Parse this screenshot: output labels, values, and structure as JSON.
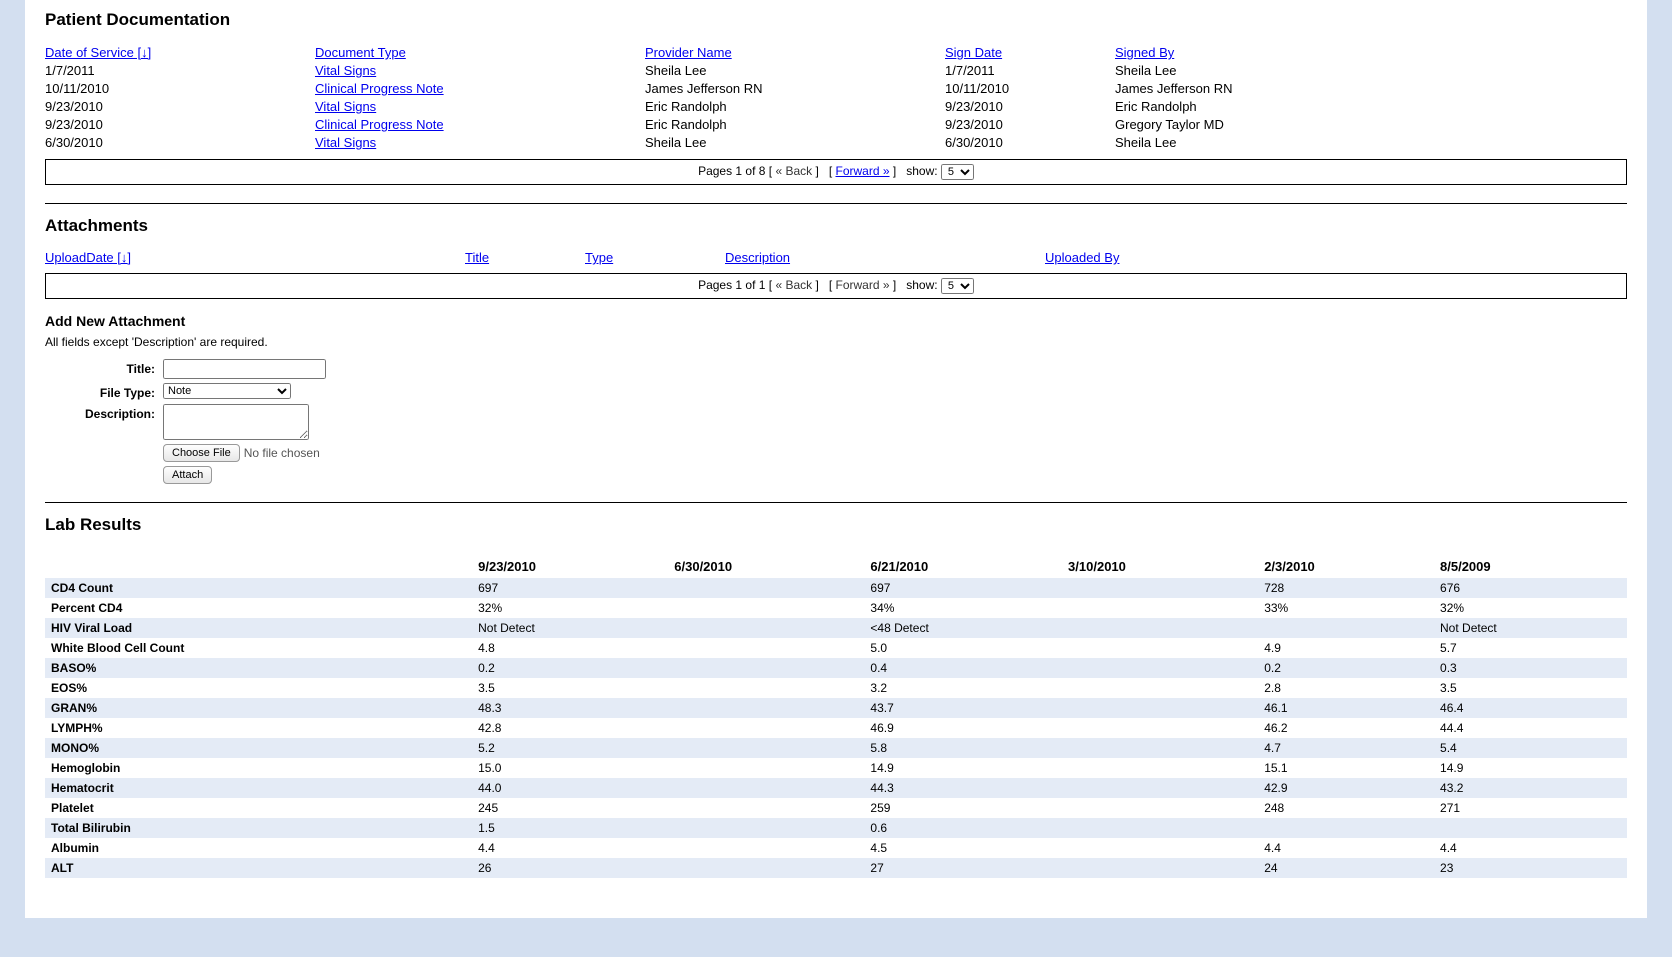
{
  "patient_doc": {
    "title": "Patient Documentation",
    "headers": {
      "date_of_service": "Date of Service [↓]",
      "doc_type": "Document Type",
      "provider": "Provider Name",
      "sign_date": "Sign Date",
      "signed_by": "Signed By"
    },
    "rows": [
      {
        "date": "1/7/2011",
        "type": "Vital Signs",
        "provider": "Sheila Lee",
        "sign_date": "1/7/2011",
        "signed_by": "Sheila Lee"
      },
      {
        "date": "10/11/2010",
        "type": "Clinical Progress Note",
        "provider": "James Jefferson RN",
        "sign_date": "10/11/2010",
        "signed_by": "James Jefferson RN"
      },
      {
        "date": "9/23/2010",
        "type": "Vital Signs",
        "provider": "Eric Randolph",
        "sign_date": "9/23/2010",
        "signed_by": "Eric Randolph"
      },
      {
        "date": "9/23/2010",
        "type": "Clinical Progress Note",
        "provider": "Eric Randolph",
        "sign_date": "9/23/2010",
        "signed_by": "Gregory Taylor MD"
      },
      {
        "date": "6/30/2010",
        "type": "Vital Signs",
        "provider": "Sheila Lee",
        "sign_date": "6/30/2010",
        "signed_by": "Sheila Lee"
      }
    ],
    "pager": {
      "text": "Pages 1 of 8",
      "back": "« Back",
      "forward": "Forward »",
      "show_label": "show:",
      "show_value": "5"
    }
  },
  "attachments": {
    "title": "Attachments",
    "headers": {
      "upload_date": "UploadDate [↓]",
      "title": "Title",
      "type": "Type",
      "description": "Description",
      "uploaded_by": "Uploaded By"
    },
    "pager": {
      "text": "Pages 1 of 1",
      "back": "« Back",
      "forward": "Forward »",
      "show_label": "show:",
      "show_value": "5"
    },
    "add_new": {
      "title": "Add New Attachment",
      "note": "All fields except 'Description' are required.",
      "labels": {
        "title": "Title:",
        "file_type": "File Type:",
        "description": "Description:"
      },
      "file_type_value": "Note",
      "choose_file": "Choose File",
      "no_file": "No file chosen",
      "attach": "Attach"
    }
  },
  "lab": {
    "title": "Lab Results",
    "dates": [
      "9/23/2010",
      "6/30/2010",
      "6/21/2010",
      "3/10/2010",
      "2/3/2010",
      "8/5/2009"
    ],
    "rows": [
      {
        "name": "CD4 Count",
        "v": [
          "697",
          "",
          "697",
          "",
          "728",
          "676"
        ]
      },
      {
        "name": "Percent CD4",
        "v": [
          "32%",
          "",
          "34%",
          "",
          "33%",
          "32%"
        ]
      },
      {
        "name": "HIV Viral Load",
        "v": [
          "Not Detect",
          "",
          "<48 Detect",
          "",
          "",
          "Not Detect"
        ]
      },
      {
        "name": "White Blood Cell Count",
        "v": [
          "4.8",
          "",
          "5.0",
          "",
          "4.9",
          "5.7"
        ]
      },
      {
        "name": "BASO%",
        "v": [
          "0.2",
          "",
          "0.4",
          "",
          "0.2",
          "0.3"
        ]
      },
      {
        "name": "EOS%",
        "v": [
          "3.5",
          "",
          "3.2",
          "",
          "2.8",
          "3.5"
        ]
      },
      {
        "name": "GRAN%",
        "v": [
          "48.3",
          "",
          "43.7",
          "",
          "46.1",
          "46.4"
        ]
      },
      {
        "name": "LYMPH%",
        "v": [
          "42.8",
          "",
          "46.9",
          "",
          "46.2",
          "44.4"
        ]
      },
      {
        "name": "MONO%",
        "v": [
          "5.2",
          "",
          "5.8",
          "",
          "4.7",
          "5.4"
        ]
      },
      {
        "name": "Hemoglobin",
        "v": [
          "15.0",
          "",
          "14.9",
          "",
          "15.1",
          "14.9"
        ]
      },
      {
        "name": "Hematocrit",
        "v": [
          "44.0",
          "",
          "44.3",
          "",
          "42.9",
          "43.2"
        ]
      },
      {
        "name": "Platelet",
        "v": [
          "245",
          "",
          "259",
          "",
          "248",
          "271"
        ]
      },
      {
        "name": "Total Bilirubin",
        "v": [
          "1.5",
          "",
          "0.6",
          "",
          "",
          ""
        ]
      },
      {
        "name": "Albumin",
        "v": [
          "4.4",
          "",
          "4.5",
          "",
          "4.4",
          "4.4"
        ]
      },
      {
        "name": "ALT",
        "v": [
          "26",
          "",
          "27",
          "",
          "24",
          "23"
        ]
      }
    ]
  }
}
